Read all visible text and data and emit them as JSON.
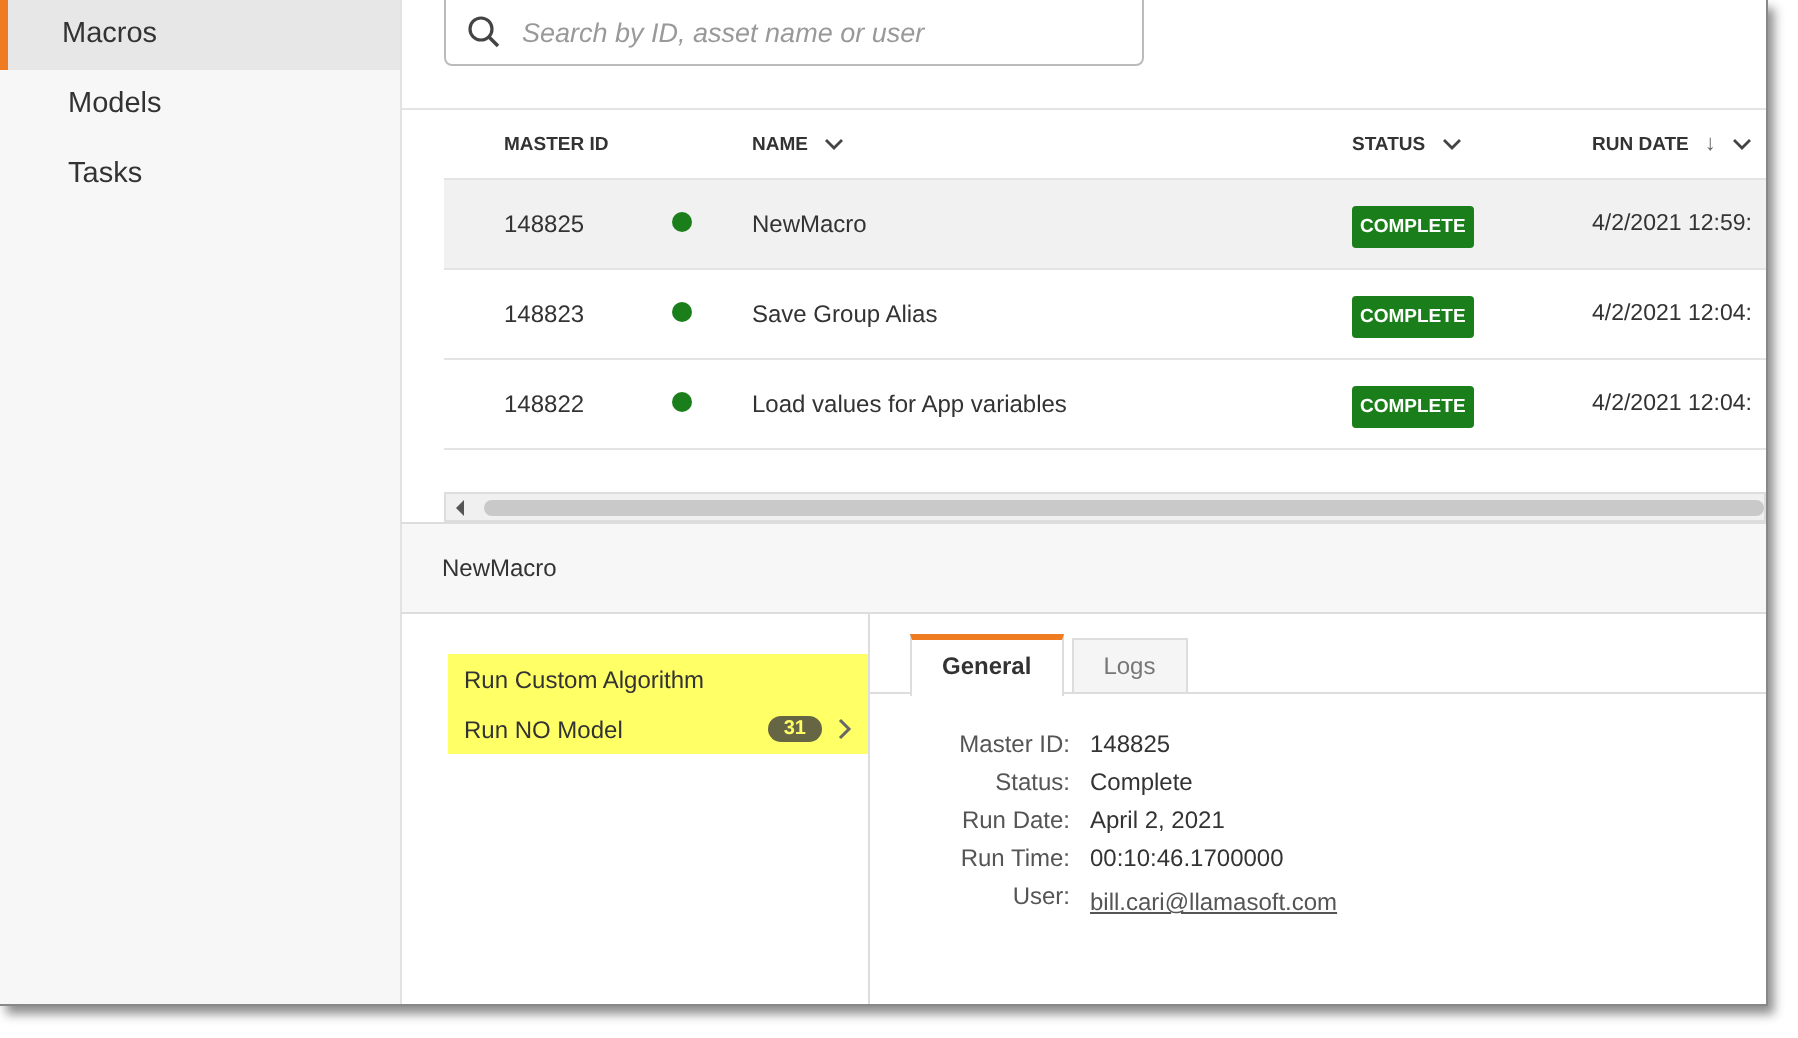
{
  "sidebar": {
    "items": [
      {
        "label": "Macros",
        "selected": true
      },
      {
        "label": "Models",
        "selected": false
      },
      {
        "label": "Tasks",
        "selected": false
      }
    ]
  },
  "search": {
    "placeholder": "Search by ID, asset name or user"
  },
  "table": {
    "columns": [
      {
        "label": "MASTER ID",
        "menu": false
      },
      {
        "label": "NAME",
        "menu": true
      },
      {
        "label": "STATUS",
        "menu": true
      },
      {
        "label": "RUN DATE",
        "sort_arrow": "↓",
        "menu": true
      }
    ],
    "rows": [
      {
        "id": "148825",
        "name": "NewMacro",
        "status": "COMPLETE",
        "color": "#1a7f1a",
        "run_date": "4/2/2021 12:59:",
        "selected": true
      },
      {
        "id": "148823",
        "name": "Save Group Alias",
        "status": "COMPLETE",
        "color": "#1a7f1a",
        "run_date": "4/2/2021 12:04:",
        "selected": false
      },
      {
        "id": "148822",
        "name": "Load values for App variables",
        "status": "COMPLETE",
        "color": "#1a7f1a",
        "run_date": "4/2/2021 12:04:",
        "selected": false
      }
    ]
  },
  "detail": {
    "title": "NewMacro",
    "steps": [
      {
        "label": "Run Custom Algorithm",
        "highlighted": true
      },
      {
        "label": "Run NO Model",
        "count": "31",
        "highlighted": true
      }
    ],
    "tabs": [
      {
        "label": "General",
        "selected": true
      },
      {
        "label": "Logs",
        "selected": false
      }
    ],
    "fields": [
      {
        "label": "Master ID:",
        "value": "148825",
        "kind": "text"
      },
      {
        "label": "Status:",
        "value": "Complete",
        "kind": "text"
      },
      {
        "label": "Run Date:",
        "value": "April 2, 2021",
        "kind": "text"
      },
      {
        "label": "Run Time:",
        "value": "00:10:46.1700000",
        "kind": "text"
      },
      {
        "label": "User:",
        "value": "bill.cari@llamasoft.com",
        "kind": "link"
      }
    ]
  }
}
